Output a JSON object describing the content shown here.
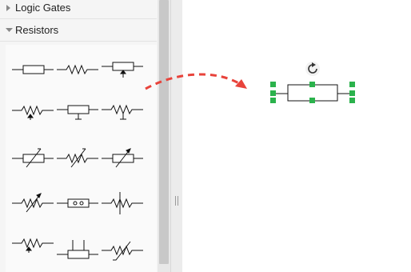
{
  "sidebar": {
    "sections": [
      {
        "label": "Logic Gates",
        "expanded": false
      },
      {
        "label": "Resistors",
        "expanded": true
      }
    ],
    "shapes": [
      "resistor-box",
      "resistor-zigzag",
      "potentiometer-box",
      "potentiometer-zigzag",
      "potentiometer-box-alt",
      "potentiometer-zigzag-alt",
      "variable-resistor-box",
      "variable-resistor-zigzag",
      "variable-resistor-box-alt",
      "adjustable-resistor-zigzag",
      "resistor-taps-box",
      "tapped-resistor-zigzag",
      "resistor-zigzag-pin",
      "resistor-box-three-terminal",
      "nonlinear-resistor-zigzag"
    ]
  },
  "canvas": {
    "selected_shape": "resistor-box"
  },
  "colors": {
    "accent": "#e8433b",
    "handle": "#2bb24c",
    "stroke": "#111111"
  }
}
